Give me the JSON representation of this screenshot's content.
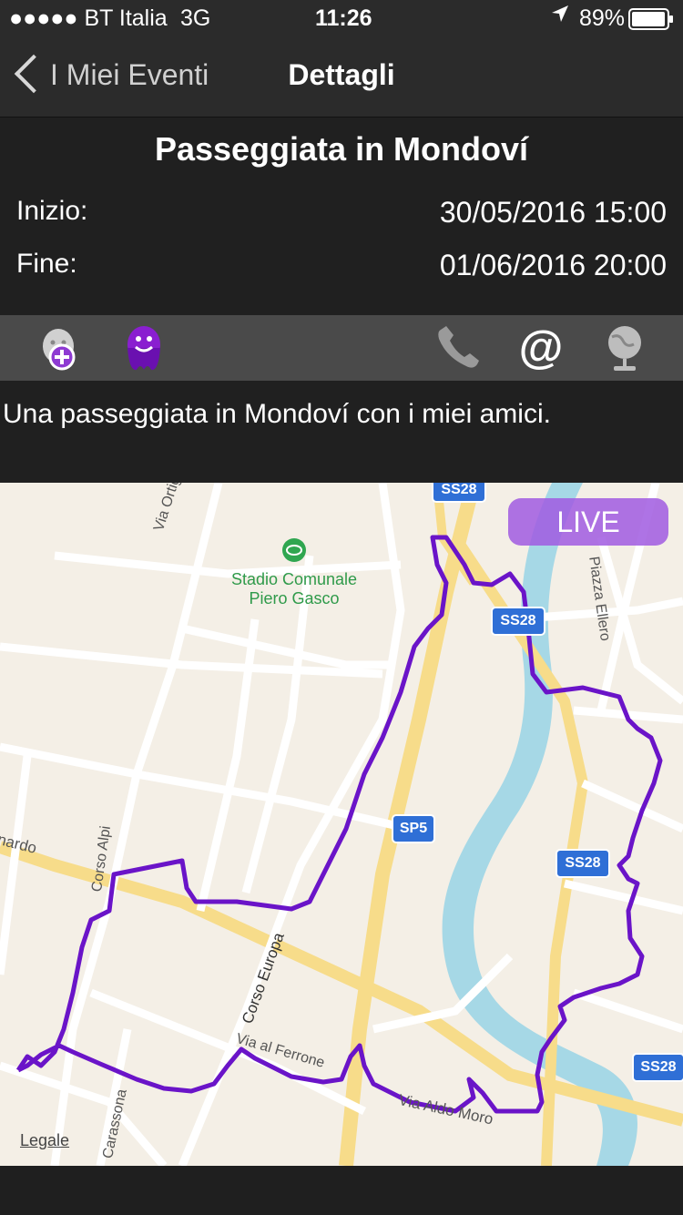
{
  "status_bar": {
    "carrier": "●●●●● BT Italia",
    "network": "3G",
    "time": "11:26",
    "battery": "89%"
  },
  "nav": {
    "back_label": "I Miei Eventi",
    "title": "Dettagli"
  },
  "event": {
    "title": "Passeggiata in Mondoví",
    "start_label": "Inizio:",
    "start_value": "30/05/2016 15:00",
    "end_label": "Fine:",
    "end_value": "01/06/2016 20:00"
  },
  "toolbar": {
    "icons": [
      "add-participant-icon",
      "participants-icon",
      "phone-icon",
      "email-icon",
      "web-icon"
    ]
  },
  "description": "Una passeggiata in Mondoví con i miei amici.",
  "map": {
    "live_label": "LIVE",
    "legal_label": "Legale",
    "poi": {
      "line1": "Stadio Comunale",
      "line2": "Piero Gasco"
    },
    "shields": [
      "SS28",
      "SS28",
      "SP5",
      "SS28",
      "SS28"
    ],
    "street_labels": [
      "Via Ortigara",
      "Corso Alpi",
      "Corso Europa",
      "Via al Ferrone",
      "Via Aldo Moro",
      "Carassona",
      "Piazza Ellero",
      "nardo"
    ],
    "route_color": "#6a14c8",
    "river_color": "#a6d8e6"
  }
}
